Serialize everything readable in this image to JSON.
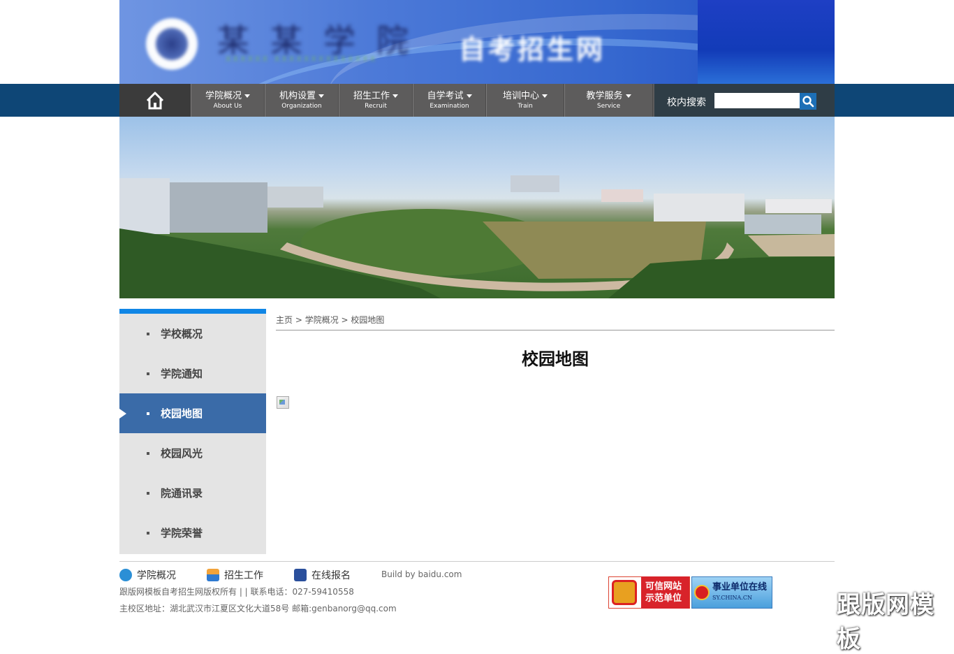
{
  "banner": {
    "school_name": "某某学院",
    "subtitle": "XXXXXX XXXXXXXXXXXXXX",
    "site_name": "自考招生网"
  },
  "nav": {
    "home_icon": "home-icon",
    "items": [
      {
        "zh": "学院概况",
        "en": "About Us"
      },
      {
        "zh": "机构设置",
        "en": "Organization"
      },
      {
        "zh": "招生工作",
        "en": "Recruit"
      },
      {
        "zh": "自学考试",
        "en": "Examination"
      },
      {
        "zh": "培训中心",
        "en": "Train"
      },
      {
        "zh": "教学服务",
        "en": "Service"
      }
    ],
    "search_label": "校内搜索",
    "search_value": "",
    "search_icon": "search-icon"
  },
  "sidebar": {
    "items": [
      {
        "label": "学校概况"
      },
      {
        "label": "学院通知"
      },
      {
        "label": "校园地图"
      },
      {
        "label": "校园风光"
      },
      {
        "label": "院通讯录"
      },
      {
        "label": "学院荣誉"
      }
    ],
    "active_index": 2
  },
  "breadcrumb": {
    "home": "主页",
    "sep1": " > ",
    "section": "学院概况",
    "sep2": " > ",
    "current": "校园地图"
  },
  "page": {
    "title": "校园地图"
  },
  "footer": {
    "links": [
      {
        "label": "学院概况",
        "icon": "chat-bubble-icon"
      },
      {
        "label": "招生工作",
        "icon": "user-icon"
      },
      {
        "label": "在线报名",
        "icon": "edit-icon"
      }
    ],
    "build": "Build by baidu.com",
    "copyright": "跟版网模板自考招生网版权所有 | | 联系电话：027-59410558",
    "address": "主校区地址：湖北武汉市江夏区文化大道58号 邮箱:genbanorg@qq.com",
    "badge1_line1": "可信网站",
    "badge1_line2": "示范单位",
    "badge2_text": "事业单位在线",
    "badge2_sub": "SY.CHINA.CN",
    "watermark": "跟版网模板"
  },
  "colors": {
    "nav_bar": "#0e4676",
    "nav_items": "#5d5c5c",
    "sidebar_active": "#3a6ba8",
    "sidebar_top": "#1086e6"
  }
}
